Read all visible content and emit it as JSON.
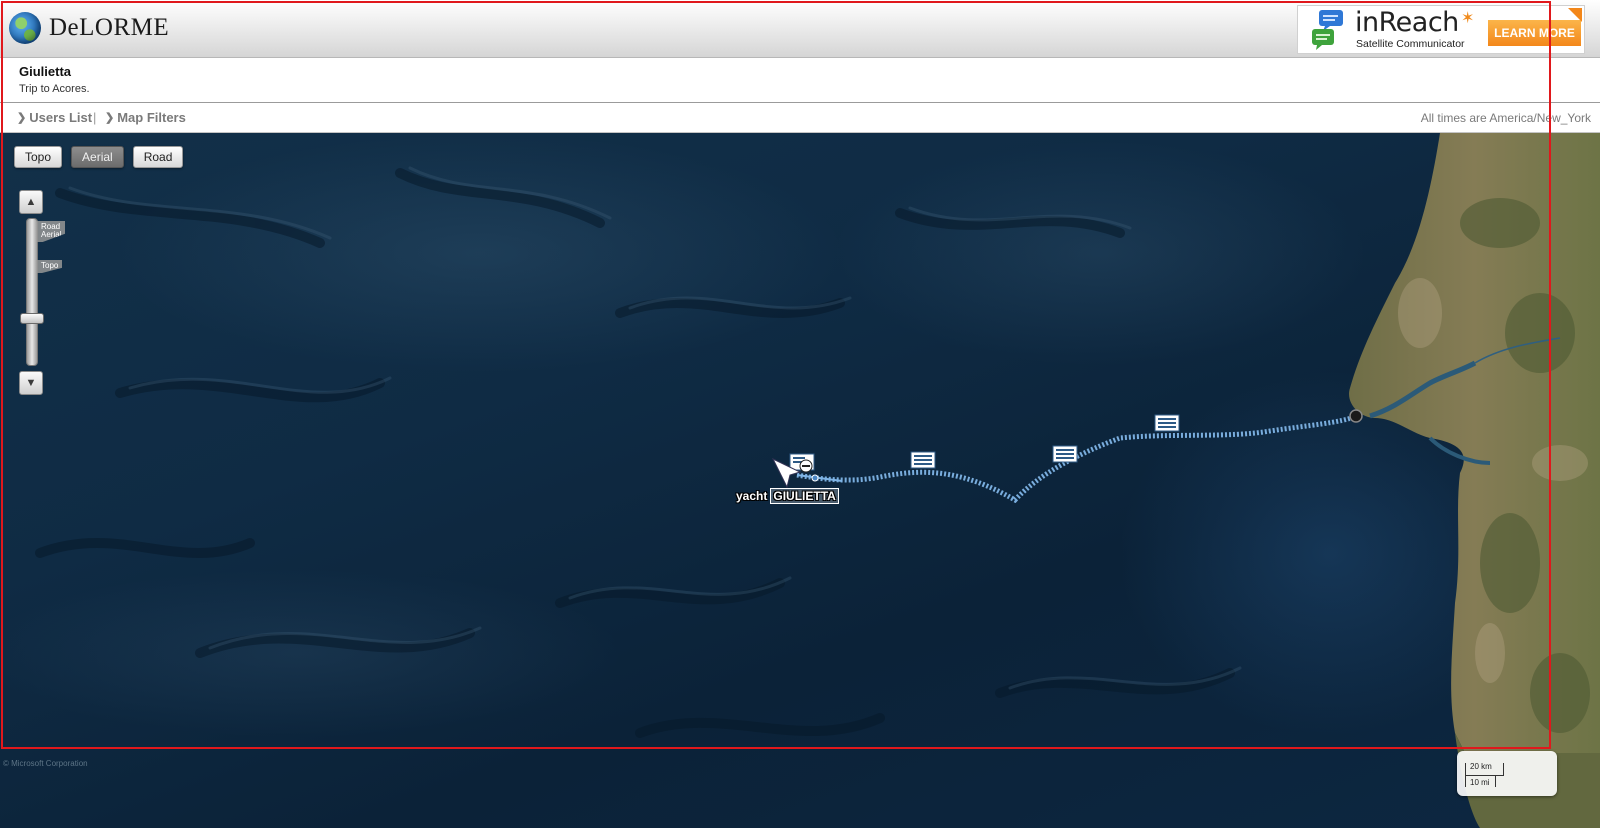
{
  "header": {
    "logo_text": "DeLORME",
    "ad": {
      "title": "inReach",
      "subtitle": "Satellite Communicator",
      "button_label": "LEARN MORE"
    }
  },
  "title_bar": {
    "user_name": "Giulietta",
    "trip_name": "Trip to Acores."
  },
  "nav": {
    "users_list": "Users List",
    "separator": "|",
    "map_filters": "Map Filters",
    "timezone_note": "All times are America/New_York"
  },
  "map": {
    "map_types": [
      {
        "label": "Topo",
        "active": false
      },
      {
        "label": "Aerial",
        "active": true
      },
      {
        "label": "Road",
        "active": false
      }
    ],
    "zoom": {
      "up_glyph": "▲",
      "down_glyph": "▼",
      "tag_road_aerial": "Road\nAerial",
      "tag_topo": "Topo"
    },
    "vessel": {
      "prefix": "yacht",
      "name": "GIULIETTA"
    },
    "copyright": "© Microsoft Corporation",
    "scale": {
      "km_label": "20 km",
      "mi_label": "10 mi"
    },
    "colors": {
      "ocean": "#0f2b44",
      "track": "#7fb4e6",
      "frame": "#e0181c"
    }
  }
}
